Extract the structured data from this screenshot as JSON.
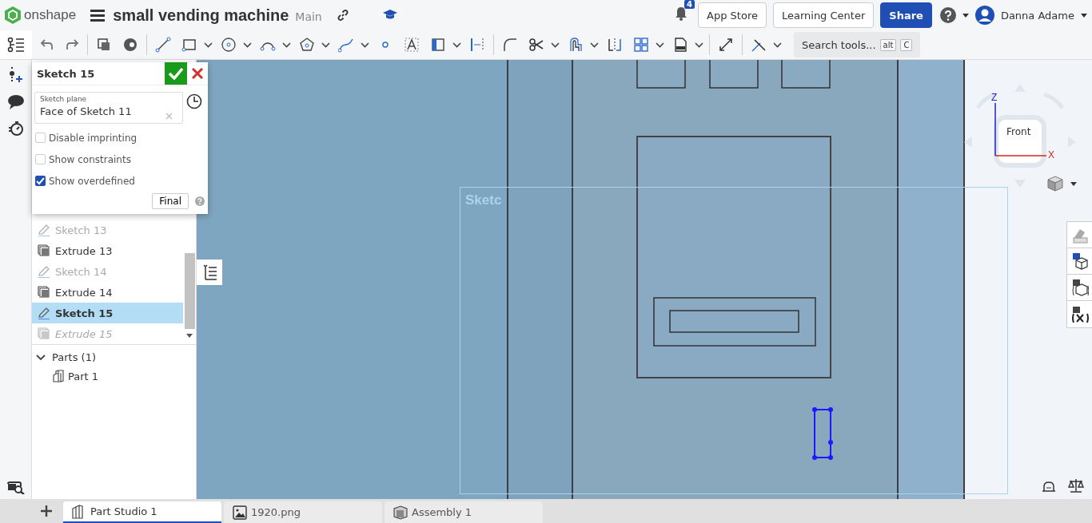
{
  "app": {
    "logo_text": "onshape",
    "document_title": "small vending machine",
    "branch": "Main"
  },
  "notifications": {
    "count": "4"
  },
  "header_buttons": [
    {
      "label": "App Store",
      "kind": "outline"
    },
    {
      "label": "Learning Center",
      "kind": "outline"
    },
    {
      "label": "Share",
      "kind": "primary"
    }
  ],
  "user": {
    "name": "Danna Adame"
  },
  "search_tools": {
    "placeholder": "Search tools...",
    "shortcut_keys": [
      "alt",
      "C"
    ]
  },
  "sketch_dialog": {
    "title": "Sketch 15",
    "plane_label": "Sketch plane",
    "plane_value": "Face of Sketch 11",
    "options": [
      {
        "label": "Disable imprinting",
        "checked": false
      },
      {
        "label": "Show constraints",
        "checked": false
      },
      {
        "label": "Show overdefined",
        "checked": true
      }
    ],
    "final_button": "Final"
  },
  "features": [
    {
      "name": "Sketch 13",
      "kind": "sketch",
      "visible": false,
      "rolled_back": false,
      "selected": false
    },
    {
      "name": "Extrude 13",
      "kind": "extrude",
      "visible": true,
      "rolled_back": false,
      "selected": false
    },
    {
      "name": "Sketch 14",
      "kind": "sketch",
      "visible": false,
      "rolled_back": false,
      "selected": false
    },
    {
      "name": "Extrude 14",
      "kind": "extrude",
      "visible": true,
      "rolled_back": false,
      "selected": false
    },
    {
      "name": "Sketch 15",
      "kind": "sketch",
      "visible": true,
      "rolled_back": false,
      "selected": true
    },
    {
      "name": "Extrude 15",
      "kind": "extrude",
      "visible": true,
      "rolled_back": true,
      "selected": false
    }
  ],
  "parts": {
    "label": "Parts (1)",
    "expanded": true,
    "items": [
      {
        "name": "Part 1"
      }
    ]
  },
  "canvas": {
    "sketch_label": "Sketc"
  },
  "view_cube": {
    "face": "Front",
    "axes": [
      "Z",
      "X"
    ]
  },
  "tabs": [
    {
      "label": "Part Studio 1",
      "kind": "part_studio",
      "selected": true
    },
    {
      "label": "1920.png",
      "kind": "image",
      "selected": false
    },
    {
      "label": "Assembly 1",
      "kind": "assembly",
      "selected": false
    }
  ]
}
